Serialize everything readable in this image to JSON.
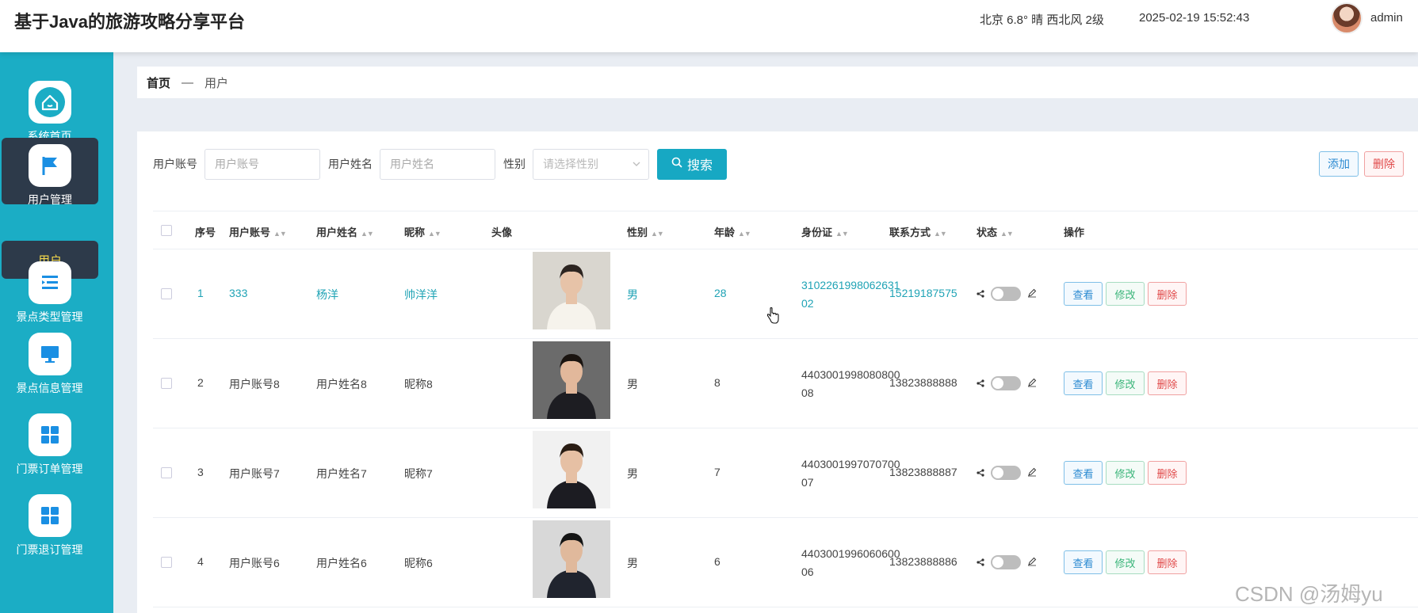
{
  "header": {
    "title": "基于Java的旅游攻略分享平台",
    "weather": "北京  6.8°  晴  西北风  2级",
    "datetime": "2025-02-19 15:52:43",
    "username": "admin"
  },
  "sidebar": {
    "items": [
      {
        "label": "系统首页",
        "icon": "home-icon"
      },
      {
        "label": "用户管理",
        "icon": "flag-icon"
      },
      {
        "label": "景点类型管理",
        "icon": "list-icon"
      },
      {
        "label": "景点信息管理",
        "icon": "monitor-icon"
      },
      {
        "label": "门票订单管理",
        "icon": "grid-icon"
      },
      {
        "label": "门票退订管理",
        "icon": "grid-icon"
      }
    ],
    "sub_item": "用户"
  },
  "breadcrumb": {
    "home": "首页",
    "separator": "—",
    "current": "用户"
  },
  "search": {
    "account_label": "用户账号",
    "account_placeholder": "用户账号",
    "name_label": "用户姓名",
    "name_placeholder": "用户姓名",
    "gender_label": "性别",
    "gender_placeholder": "请选择性别",
    "button_label": "搜索"
  },
  "actions": {
    "add": "添加",
    "delete": "删除"
  },
  "table": {
    "headers": [
      "序号",
      "用户账号",
      "用户姓名",
      "昵称",
      "头像",
      "性别",
      "年龄",
      "身份证",
      "联系方式",
      "状态",
      "操作"
    ],
    "rows": [
      {
        "no": "1",
        "account": "333",
        "name": "杨洋",
        "nickname": "帅洋洋",
        "gender": "男",
        "age": "28",
        "idcard": "310226199806263102",
        "phone": "15219187575"
      },
      {
        "no": "2",
        "account": "用户账号8",
        "name": "用户姓名8",
        "nickname": "昵称8",
        "gender": "男",
        "age": "8",
        "idcard": "440300199808080008",
        "phone": "13823888888"
      },
      {
        "no": "3",
        "account": "用户账号7",
        "name": "用户姓名7",
        "nickname": "昵称7",
        "gender": "男",
        "age": "7",
        "idcard": "440300199707070007",
        "phone": "13823888887"
      },
      {
        "no": "4",
        "account": "用户账号6",
        "name": "用户姓名6",
        "nickname": "昵称6",
        "gender": "男",
        "age": "6",
        "idcard": "440300199606060006",
        "phone": "13823888886"
      }
    ],
    "op_view": "查看",
    "op_edit": "修改",
    "op_delete": "删除"
  },
  "watermark": "CSDN @汤姆yu",
  "colors": {
    "sidebar": "#1badc5",
    "accent": "#17a8c3",
    "active_menu": "#2d3a4a",
    "link": "#1fa3b5"
  }
}
